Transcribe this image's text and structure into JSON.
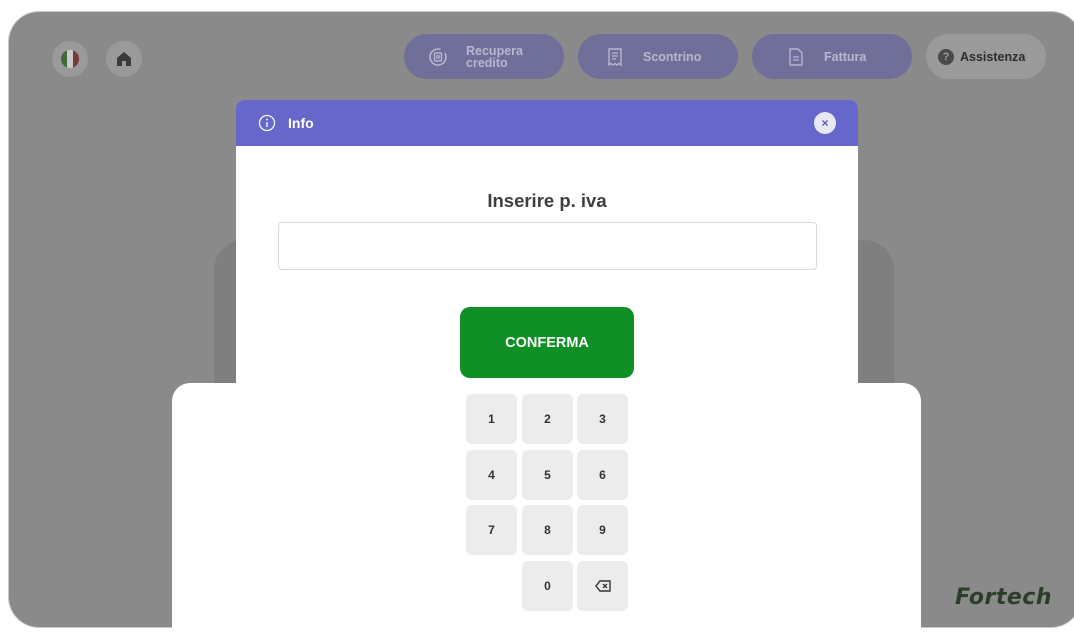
{
  "topbar": {
    "language_icon": "italy-flag-icon",
    "home_icon": "home-icon",
    "recover_label_line1": "Recupera",
    "recover_label_line2": "credito",
    "receipt_label": "Scontrino",
    "invoice_label": "Fattura",
    "help_label": "Assistenza",
    "help_symbol": "?"
  },
  "dialog": {
    "header_title": "Info",
    "close_symbol": "×",
    "title": "Inserire p. iva",
    "input_value": "",
    "confirm_label": "CONFERMA"
  },
  "keypad": {
    "keys": [
      "1",
      "2",
      "3",
      "4",
      "5",
      "6",
      "7",
      "8",
      "9",
      "0"
    ],
    "backspace_icon": "backspace-icon"
  },
  "brand": "Fortech",
  "colors": {
    "header": "#6767cb",
    "confirm": "#0f8f26",
    "overlay": "#8a8a8a"
  }
}
